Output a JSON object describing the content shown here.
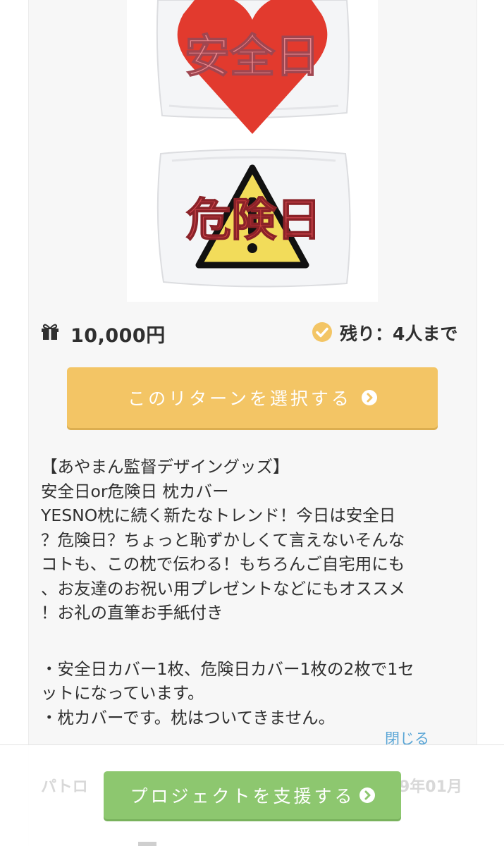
{
  "product_image": {
    "top_pillow_text": "安全日",
    "bottom_pillow_text": "危険日"
  },
  "reward": {
    "price": "10,000円",
    "remaining": "残り：4人まで",
    "select_label": "このリターンを選択する",
    "accent_color": "#f3c565"
  },
  "description": {
    "lines": [
      "【あやまん監督デザイングッズ】",
      "安全日or危険日 枕カバー",
      "YESNO枕に続く新たなトレンド！今日は安全日",
      "？危険日？ちょっと恥ずかしくて言えないそんな",
      "コトも、この枕で伝わる！もちろんご自宅用にも",
      "、お友達のお祝い用プレゼントなどにもオススメ",
      "！お礼の直筆お手紙付き"
    ],
    "bullets": [
      "・安全日カバー1枚、危険日カバー1枚の2枚で1セ",
      "ットになっています。",
      "・枕カバーです。枕はついてきません。"
    ],
    "close_label": "閉じる"
  },
  "bottom_bar": {
    "faded_left": "パトロ",
    "faded_right": "9年01月",
    "support_label": "プロジェクトを支援する",
    "support_color": "#8dc76f"
  }
}
